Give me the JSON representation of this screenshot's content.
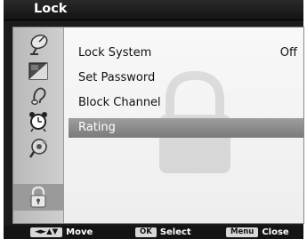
{
  "window": {
    "title": "Lock"
  },
  "sidebar": {
    "icons": [
      {
        "name": "satellite-dish-icon"
      },
      {
        "name": "picture-icon"
      },
      {
        "name": "audio-icon"
      },
      {
        "name": "alarm-clock-icon"
      },
      {
        "name": "settings-icon"
      },
      {
        "name": "lock-icon",
        "selected": true
      }
    ]
  },
  "menu": {
    "items": [
      {
        "label": "Lock System",
        "value": "Off"
      },
      {
        "label": "Set Password",
        "value": ""
      },
      {
        "label": "Block Channel",
        "value": ""
      },
      {
        "label": "Rating",
        "value": "",
        "selected": true
      }
    ]
  },
  "footer": {
    "move": {
      "key": "◄►▲▼",
      "label": "Move"
    },
    "select": {
      "key": "OK",
      "label": "Select"
    },
    "close": {
      "key": "Menu",
      "label": "Close"
    }
  },
  "colors": {
    "highlight": "#8c8c8c",
    "frame": "#1b1b1b",
    "panel": "#f2f2f2"
  }
}
